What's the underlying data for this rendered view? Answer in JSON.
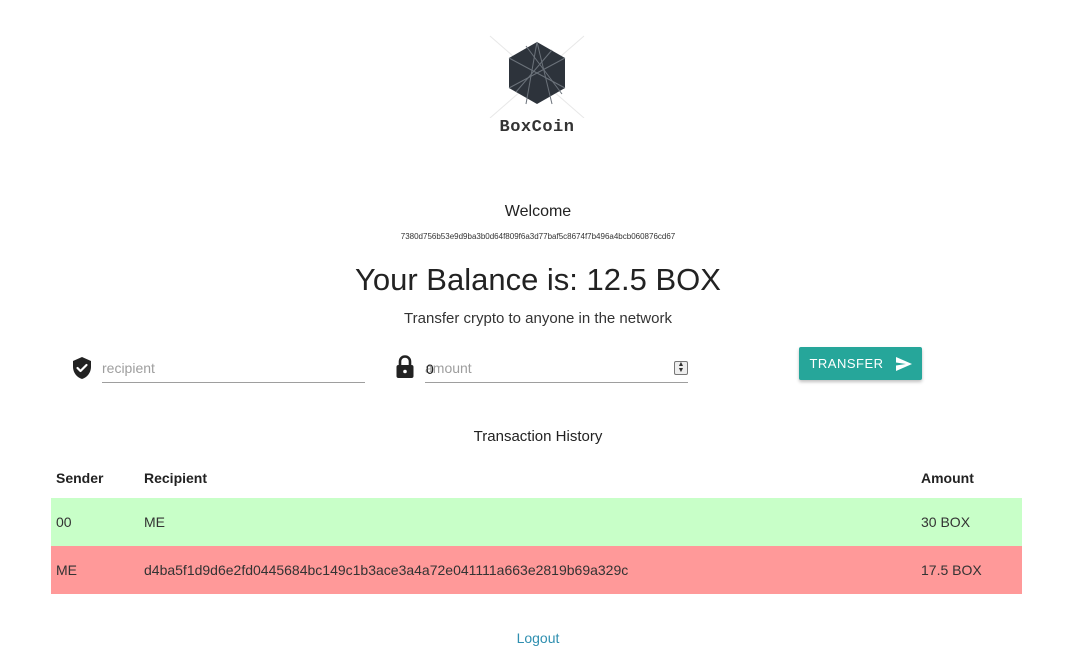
{
  "brand": {
    "name": "BoxCoin",
    "logo_icon": "hexagon-logo-icon"
  },
  "account": {
    "welcome": "Welcome",
    "address": "7380d756b53e9d9ba3b0d64f809f6a3d77baf5c8674f7b496a4bcb060876cd67",
    "balance": "Your Balance is: 12.5 BOX",
    "subtitle": "Transfer crypto to anyone in the network"
  },
  "transfer": {
    "recipient_placeholder": "recipient",
    "recipient_icon": "verified-shield-icon",
    "amount_placeholder": "amount",
    "amount_value": "0",
    "amount_icon": "lock-icon",
    "button_label": "TRANSFER",
    "button_icon": "send-icon"
  },
  "history": {
    "title": "Transaction History",
    "columns": [
      "Sender",
      "Recipient",
      "Amount"
    ],
    "rows": [
      {
        "sender": "00",
        "recipient": "ME",
        "amount": "30 BOX",
        "status_color": "#c8ffc8"
      },
      {
        "sender": "ME",
        "recipient": "d4ba5f1d9d6e2fd0445684bc149c1b3ace3a4a72e041111a663e2819b69a329c",
        "amount": "17.5 BOX",
        "status_color": "#ff9999"
      }
    ]
  },
  "footer": {
    "logout": "Logout"
  },
  "colors": {
    "accent": "#26a69a",
    "link": "#2f8fb0",
    "incoming": "#c8ffc8",
    "outgoing": "#ff9999"
  }
}
